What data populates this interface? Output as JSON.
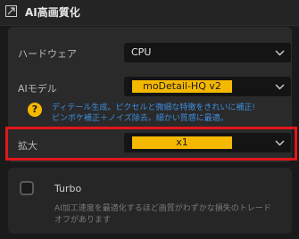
{
  "header": {
    "title": "AI高画質化",
    "icon": "expand-icon"
  },
  "rows": {
    "hardware": {
      "label": "ハードウェア",
      "value": "CPU"
    },
    "ai_model": {
      "label": "AIモデル",
      "value": "moDetail-HQ  v2",
      "description_line1": "ディテール生成。ピクセルと微細な特徴をきれいに補正!",
      "description_line2": "ピンボケ補正＋ノイズ除去。細かい質感に最適。"
    },
    "scale": {
      "label": "拡大",
      "value": "x1"
    }
  },
  "turbo": {
    "label": "Turbo",
    "description_line1": "AI加工速度を最適化するほど画質がわずかな損失のトレード",
    "description_line2": "オフがあります"
  },
  "colors": {
    "accent": "#f5b800",
    "highlight": "#e0161b",
    "description": "#3d8fe0"
  }
}
